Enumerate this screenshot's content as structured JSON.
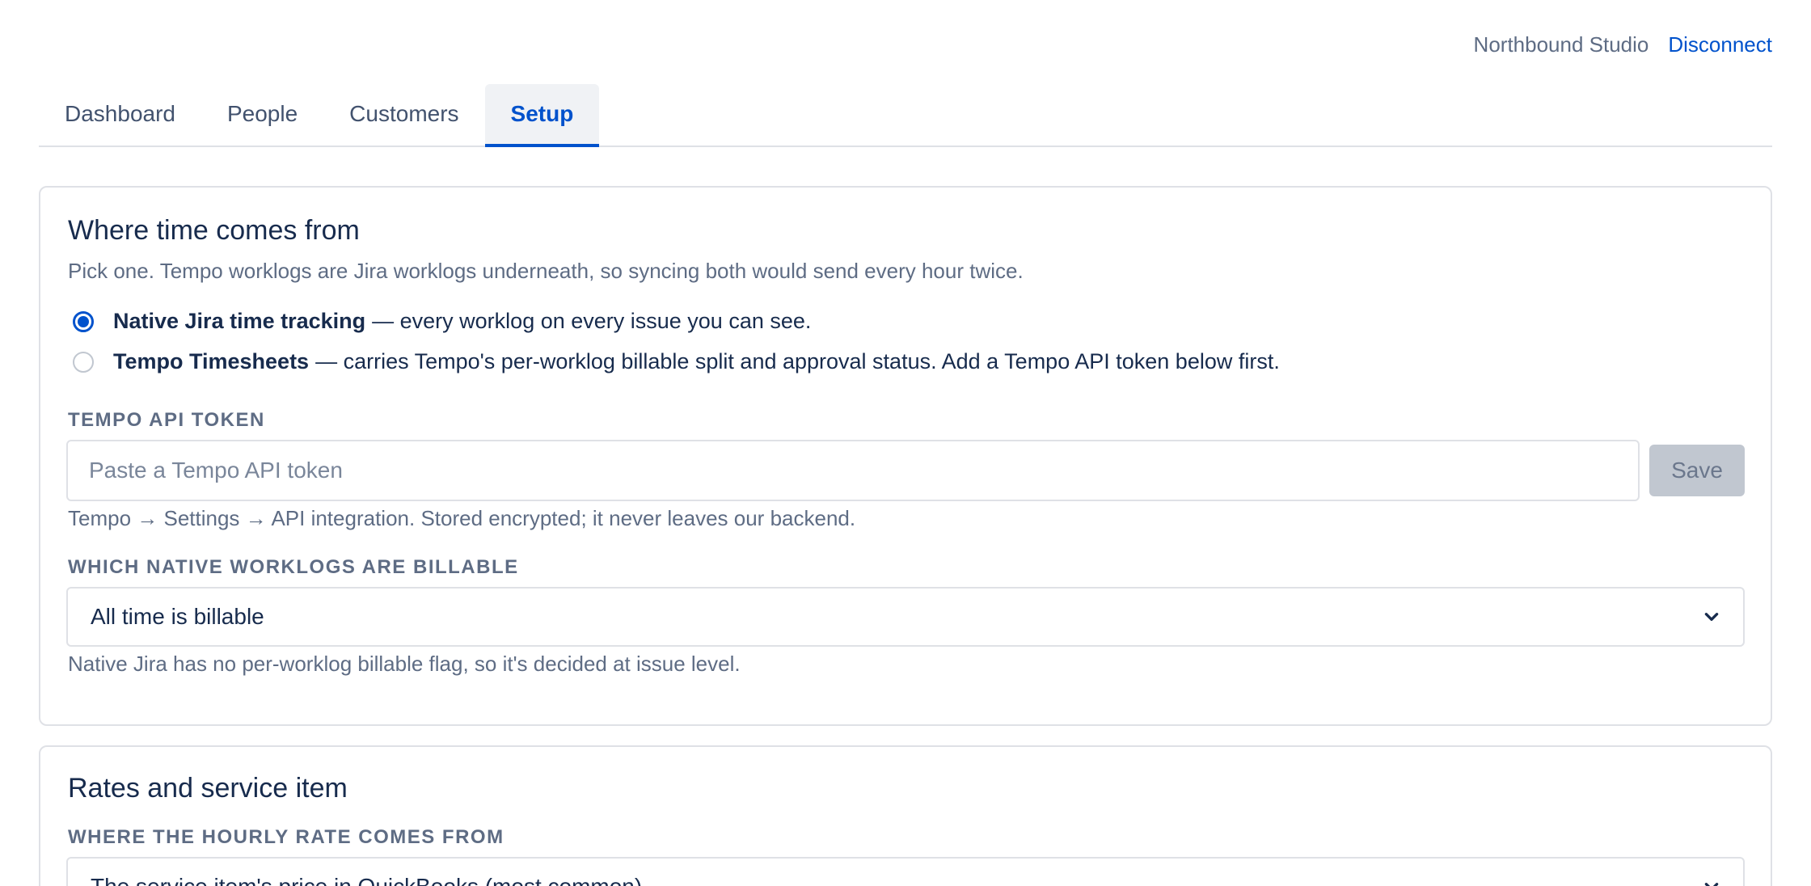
{
  "account": {
    "org_name": "Northbound Studio",
    "disconnect_label": "Disconnect"
  },
  "tabs": [
    {
      "label": "Dashboard",
      "active": false
    },
    {
      "label": "People",
      "active": false
    },
    {
      "label": "Customers",
      "active": false
    },
    {
      "label": "Setup",
      "active": true
    }
  ],
  "time_source": {
    "title": "Where time comes from",
    "description": "Pick one. Tempo worklogs are Jira worklogs underneath, so syncing both would send every hour twice.",
    "options": [
      {
        "name": "Native Jira time tracking",
        "detail": "— every worklog on every issue you can see.",
        "selected": true
      },
      {
        "name": "Tempo Timesheets",
        "detail": "— carries Tempo's per-worklog billable split and approval status. Add a Tempo API token below first.",
        "selected": false
      }
    ],
    "token": {
      "label": "TEMPO API TOKEN",
      "placeholder": "Paste a Tempo API token",
      "value": "",
      "save_label": "Save",
      "help": "Tempo → Settings → API integration. Stored encrypted; it never leaves our backend."
    },
    "billable": {
      "label": "WHICH NATIVE WORKLOGS ARE BILLABLE",
      "selected": "All time is billable",
      "help": "Native Jira has no per-worklog billable flag, so it's decided at issue level."
    }
  },
  "rates": {
    "title": "Rates and service item",
    "rate_source": {
      "label": "WHERE THE HOURLY RATE COMES FROM",
      "selected": "The service item's price in QuickBooks (most common)"
    }
  },
  "colors": {
    "accent": "#0052cc",
    "text": "#172b4d",
    "muted": "#5e6c84",
    "border": "#dfe1e6",
    "disabled_button": "#c1c7d0"
  },
  "icons": {
    "select_chevron": "chevron-down-icon"
  }
}
